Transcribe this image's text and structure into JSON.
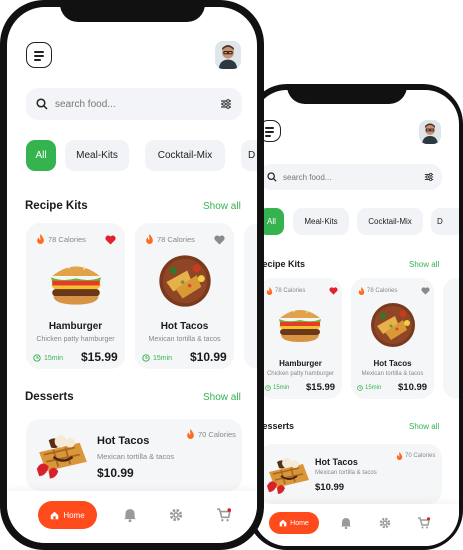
{
  "search": {
    "placeholder": "search food..."
  },
  "categories": [
    "All",
    "Meal-Kits",
    "Cocktail-Mix",
    "D"
  ],
  "sections": {
    "recipe_kits": "Recipe Kits",
    "desserts": "Desserts",
    "show_all": "Show all"
  },
  "recipe_kits": [
    {
      "calories": "78 Calories",
      "name": "Hamburger",
      "desc": "Chicken patty hamburger",
      "time": "15min",
      "price": "$15.99",
      "favorite": true
    },
    {
      "calories": "78 Calories",
      "name": "Hot Tacos",
      "desc": "Mexican tortilla & tacos",
      "time": "15min",
      "price": "$10.99",
      "favorite": false
    }
  ],
  "dessert": {
    "calories": "70 Calories",
    "name": "Hot Tacos",
    "desc": "Mexican tortilla & tacos",
    "price": "$10.99"
  },
  "nav": {
    "home": "Home"
  },
  "colors": {
    "accent_green": "#35b34f",
    "home_orange": "#ff4a1c",
    "heart_red": "#e0222e"
  },
  "icons": [
    "menu-icon",
    "search-icon",
    "filter-icon",
    "flame-icon",
    "heart-icon",
    "clock-icon",
    "home-icon",
    "bell-icon",
    "gear-icon",
    "cart-icon"
  ]
}
